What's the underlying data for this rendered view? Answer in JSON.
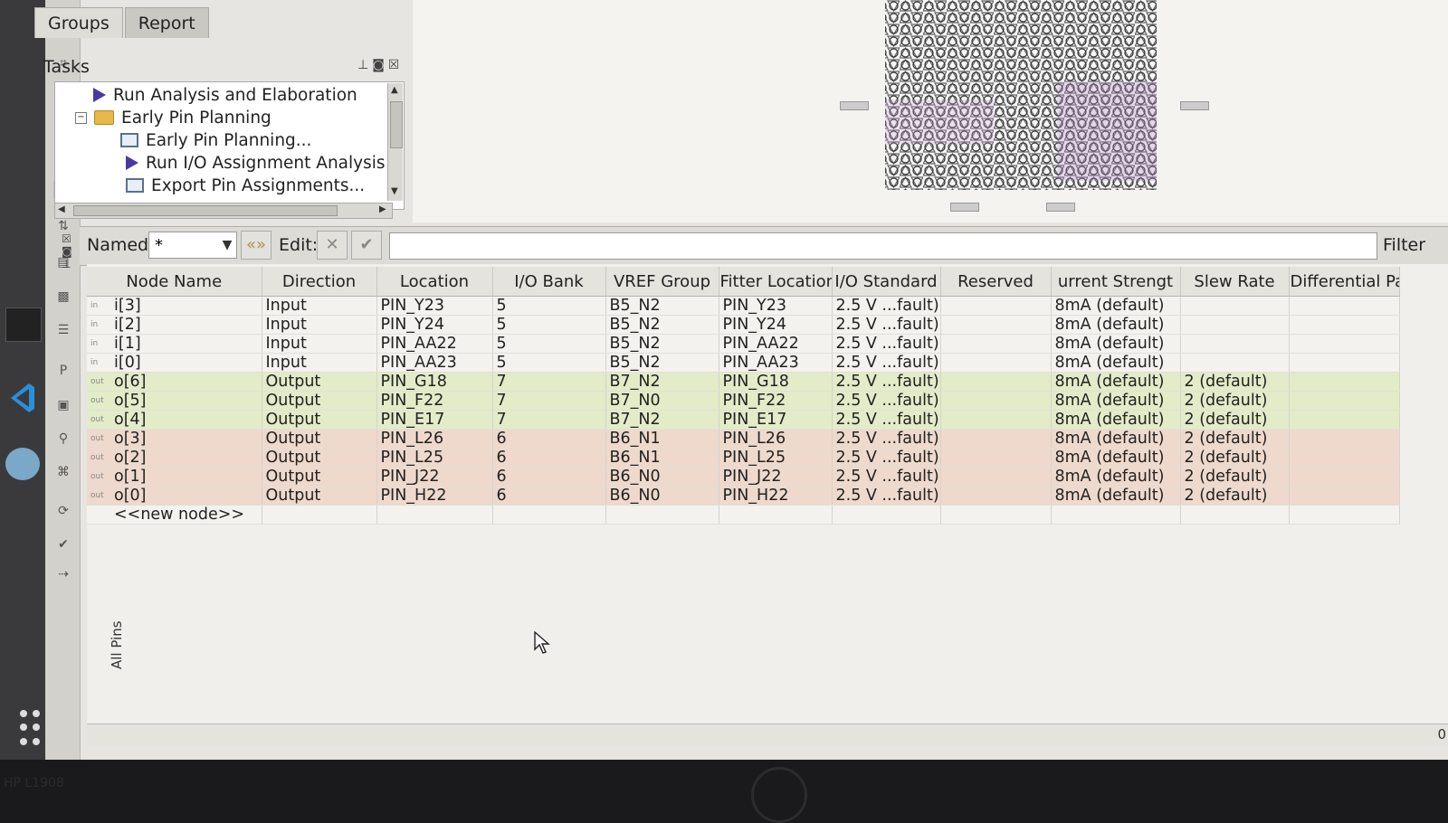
{
  "tabs": [
    "Groups",
    "Report"
  ],
  "tasks": {
    "title": "Tasks",
    "items": [
      {
        "label": "Run Analysis and Elaboration",
        "icon": "play-icon",
        "indent": 0
      },
      {
        "label": "Early Pin Planning",
        "icon": "folder-icon",
        "indent": 0
      },
      {
        "label": "Early Pin Planning...",
        "icon": "window-icon",
        "indent": 1
      },
      {
        "label": "Run I/O Assignment Analysis",
        "icon": "play-icon",
        "indent": 1
      },
      {
        "label": "Export Pin Assignments...",
        "icon": "window-icon",
        "indent": 1
      }
    ]
  },
  "filter": {
    "named_label": "Named:",
    "named_value": "*",
    "edit_label": "Edit:",
    "filter_label": "Filter"
  },
  "table": {
    "panel_label": "All Pins",
    "columns": [
      "Node Name",
      "Direction",
      "Location",
      "I/O Bank",
      "VREF Group",
      "Fitter Location",
      "I/O Standard",
      "Reserved",
      "urrent Strengt",
      "Slew Rate",
      "Differential Pai"
    ],
    "rows": [
      {
        "dir_icon": "in",
        "name": "i[3]",
        "direction": "Input",
        "location": "PIN_Y23",
        "bank": "5",
        "vref": "B5_N2",
        "fitter": "PIN_Y23",
        "iostd": "2.5 V ...fault)",
        "reserved": "",
        "current": "8mA (default)",
        "slew": "",
        "diff": ""
      },
      {
        "dir_icon": "in",
        "name": "i[2]",
        "direction": "Input",
        "location": "PIN_Y24",
        "bank": "5",
        "vref": "B5_N2",
        "fitter": "PIN_Y24",
        "iostd": "2.5 V ...fault)",
        "reserved": "",
        "current": "8mA (default)",
        "slew": "",
        "diff": ""
      },
      {
        "dir_icon": "in",
        "name": "i[1]",
        "direction": "Input",
        "location": "PIN_AA22",
        "bank": "5",
        "vref": "B5_N2",
        "fitter": "PIN_AA22",
        "iostd": "2.5 V ...fault)",
        "reserved": "",
        "current": "8mA (default)",
        "slew": "",
        "diff": ""
      },
      {
        "dir_icon": "in",
        "name": "i[0]",
        "direction": "Input",
        "location": "PIN_AA23",
        "bank": "5",
        "vref": "B5_N2",
        "fitter": "PIN_AA23",
        "iostd": "2.5 V ...fault)",
        "reserved": "",
        "current": "8mA (default)",
        "slew": "",
        "diff": ""
      },
      {
        "dir_icon": "out",
        "name": "o[6]",
        "direction": "Output",
        "location": "PIN_G18",
        "bank": "7",
        "vref": "B7_N2",
        "fitter": "PIN_G18",
        "iostd": "2.5 V ...fault)",
        "reserved": "",
        "current": "8mA (default)",
        "slew": "2 (default)",
        "diff": ""
      },
      {
        "dir_icon": "out",
        "name": "o[5]",
        "direction": "Output",
        "location": "PIN_F22",
        "bank": "7",
        "vref": "B7_N0",
        "fitter": "PIN_F22",
        "iostd": "2.5 V ...fault)",
        "reserved": "",
        "current": "8mA (default)",
        "slew": "2 (default)",
        "diff": ""
      },
      {
        "dir_icon": "out",
        "name": "o[4]",
        "direction": "Output",
        "location": "PIN_E17",
        "bank": "7",
        "vref": "B7_N2",
        "fitter": "PIN_E17",
        "iostd": "2.5 V ...fault)",
        "reserved": "",
        "current": "8mA (default)",
        "slew": "2 (default)",
        "diff": ""
      },
      {
        "dir_icon": "out",
        "name": "o[3]",
        "direction": "Output",
        "location": "PIN_L26",
        "bank": "6",
        "vref": "B6_N1",
        "fitter": "PIN_L26",
        "iostd": "2.5 V ...fault)",
        "reserved": "",
        "current": "8mA (default)",
        "slew": "2 (default)",
        "diff": ""
      },
      {
        "dir_icon": "out",
        "name": "o[2]",
        "direction": "Output",
        "location": "PIN_L25",
        "bank": "6",
        "vref": "B6_N1",
        "fitter": "PIN_L25",
        "iostd": "2.5 V ...fault)",
        "reserved": "",
        "current": "8mA (default)",
        "slew": "2 (default)",
        "diff": ""
      },
      {
        "dir_icon": "out",
        "name": "o[1]",
        "direction": "Output",
        "location": "PIN_J22",
        "bank": "6",
        "vref": "B6_N0",
        "fitter": "PIN_J22",
        "iostd": "2.5 V ...fault)",
        "reserved": "",
        "current": "8mA (default)",
        "slew": "2 (default)",
        "diff": ""
      },
      {
        "dir_icon": "out",
        "name": "o[0]",
        "direction": "Output",
        "location": "PIN_H22",
        "bank": "6",
        "vref": "B6_N0",
        "fitter": "PIN_H22",
        "iostd": "2.5 V ...fault)",
        "reserved": "",
        "current": "8mA (default)",
        "slew": "2 (default)",
        "diff": ""
      }
    ],
    "new_node": "<<new node>>"
  },
  "bezel": {
    "model": "HP L1908",
    "status_corner": "0"
  },
  "colors": {
    "bank7_row": "#e2ecc8",
    "bank6_row": "#efd9cc",
    "input_row": "#f3f2ee"
  }
}
